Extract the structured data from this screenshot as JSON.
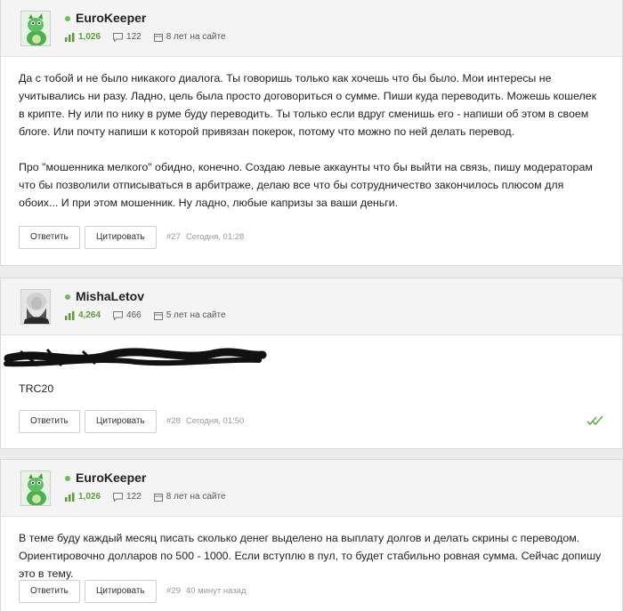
{
  "posts": [
    {
      "username": "EuroKeeper",
      "avatar": "green-dragon-avatar",
      "reputation": "1,026",
      "posts_count": "122",
      "tenure": "8 лет на сайте",
      "paragraphs": [
        "Да с тобой и не было никакого диалога. Ты говоришь только как хочешь что бы было. Мои интересы не учитывались ни разу. Ладно, цель была просто договориться о сумме. Пиши куда переводить. Можешь кошелек в крипте. Ну или по нику в руме буду переводить. Ты только если вдруг сменишь его - напиши об этом в своем блоге. Или почту напиши к которой привязан покерок, потому что можно по ней делать перевод.",
        "Про \"мошенника мелкого\" обидно, конечно. Создаю левые аккаунты что бы выйти на связь, пишу модераторам что бы позволили отписываться в арбитраже, делаю все что бы сотрудничество закончилось плюсом для обоих... И при этом мошенник. Ну ладно, любые капризы за ваши деньги."
      ],
      "reply_label": "Ответить",
      "quote_label": "Цитировать",
      "number": "#27",
      "time": "Сегодня, 01:28"
    },
    {
      "username": "MishaLetov",
      "avatar": "bearded-portrait-avatar",
      "reputation": "4,264",
      "posts_count": "466",
      "tenure": "5 лет на сайте",
      "paragraphs": [
        "TRC20"
      ],
      "reply_label": "Ответить",
      "quote_label": "Цитировать",
      "number": "#28",
      "time": "Сегодня, 01:50",
      "read_icon": "double-check-icon"
    },
    {
      "username": "EuroKeeper",
      "avatar": "green-dragon-avatar",
      "reputation": "1,026",
      "posts_count": "122",
      "tenure": "8 лет на сайте",
      "paragraphs": [
        "В теме буду каждый месяц писать сколько денег выделено на выплату долгов и делать скрины с переводом. Ориентировочно долларов по 500 - 1000. Если вступлю в пул, то будет стабильно ровная сумма. Сейчас допишу это в тему."
      ],
      "reply_label": "Ответить",
      "quote_label": "Цитировать",
      "number": "#29",
      "time": "40 минут назад"
    }
  ],
  "colors": {
    "accent": "#5a9e3a",
    "online": "#6bbf59",
    "meta": "#999999",
    "check": "#6aa84f"
  }
}
